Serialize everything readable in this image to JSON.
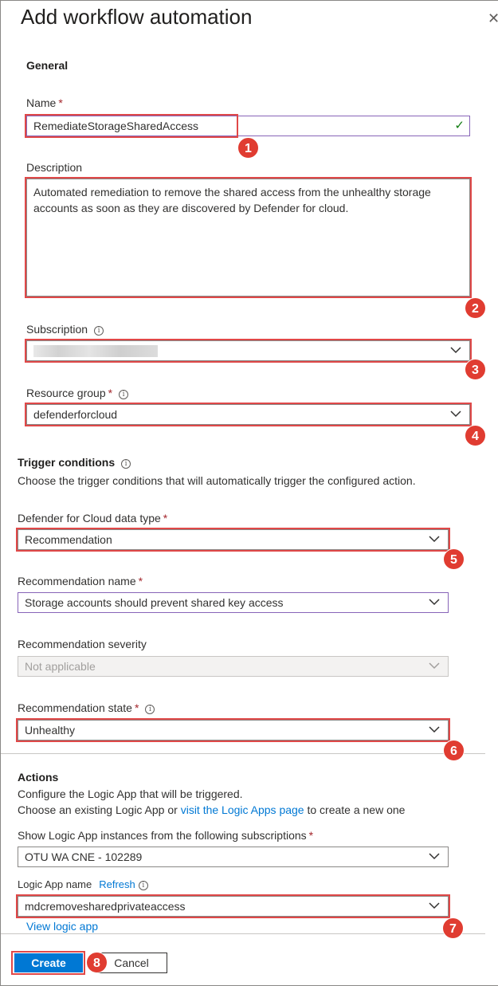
{
  "panel": {
    "title": "Add workflow automation",
    "close_symbol": "✕"
  },
  "general": {
    "heading": "General",
    "name_label": "Name",
    "name_value": "RemediateStorageSharedAccess",
    "description_label": "Description",
    "description_line1": "Automated remediation to remove the shared access from the unhealthy storage",
    "description_line2": "accounts as soon as they are discovered by Defender for cloud.",
    "subscription_label": "Subscription",
    "subscription_value": "",
    "resource_group_label": "Resource group",
    "resource_group_value": "defenderforcloud"
  },
  "trigger": {
    "heading": "Trigger conditions",
    "description": "Choose the trigger conditions that will automatically trigger the configured action.",
    "data_type_label": "Defender for Cloud data type",
    "data_type_value": "Recommendation",
    "rec_name_label": "Recommendation name",
    "rec_name_value": "Storage accounts should prevent shared key access",
    "severity_label": "Recommendation severity",
    "severity_value": "Not applicable",
    "state_label": "Recommendation state",
    "state_value": "Unhealthy"
  },
  "actions": {
    "heading": "Actions",
    "line1": "Configure the Logic App that will be triggered.",
    "line2_prefix": "Choose an existing Logic App or ",
    "line2_link": "visit the Logic Apps page",
    "line2_suffix": " to create a new one",
    "subs_label": "Show Logic App instances from the following subscriptions",
    "subs_value": "OTU WA CNE - 102289",
    "logic_app_label": "Logic App name",
    "refresh_link": "Refresh",
    "logic_app_value": "mdcremovesharedprivateaccess",
    "view_link": "View logic app"
  },
  "footer": {
    "create_label": "Create",
    "cancel_label": "Cancel"
  },
  "required_marker": "*",
  "info_symbol": "i",
  "check_symbol": "✓",
  "callouts": [
    "1",
    "2",
    "3",
    "4",
    "5",
    "6",
    "7",
    "8"
  ],
  "colors": {
    "accent": "#0078d4",
    "highlight": "#e04848",
    "badge": "#e03c31",
    "required": "#a4262c",
    "valid": "#107c10"
  },
  "icons": {
    "close": "close-icon",
    "info": "info-icon",
    "check": "checkmark-icon",
    "dropdown": "chevron-down-icon"
  }
}
